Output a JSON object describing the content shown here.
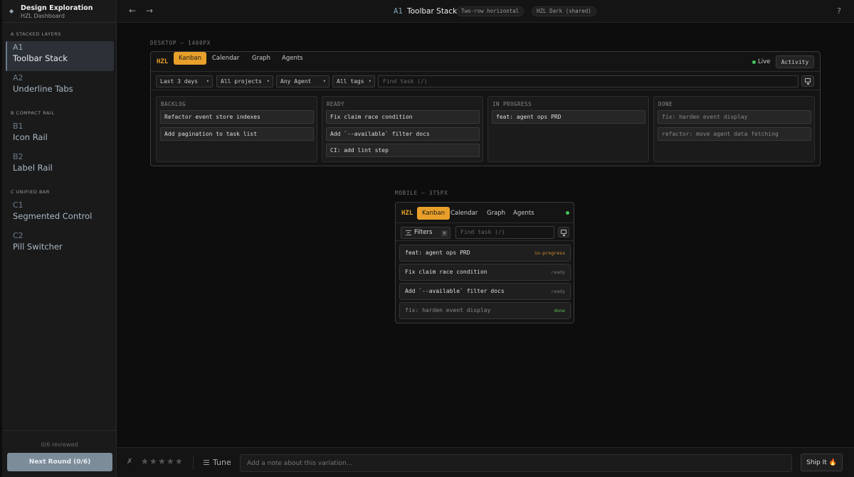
{
  "sidebar": {
    "title": "Design Exploration",
    "subtitle": "HZL Dashboard",
    "sections": [
      {
        "label": "A  STACKED LAYERS",
        "items": [
          {
            "code": "A1",
            "name": "Toolbar Stack",
            "active": true
          },
          {
            "code": "A2",
            "name": "Underline Tabs",
            "active": false
          }
        ]
      },
      {
        "label": "B  COMPACT RAIL",
        "items": [
          {
            "code": "B1",
            "name": "Icon Rail",
            "active": false
          },
          {
            "code": "B2",
            "name": "Label Rail",
            "active": false
          }
        ]
      },
      {
        "label": "C  UNIFIED BAR",
        "items": [
          {
            "code": "C1",
            "name": "Segmented Control",
            "active": false
          },
          {
            "code": "C2",
            "name": "Pill Switcher",
            "active": false
          }
        ]
      }
    ],
    "reviewed": "0/6 reviewed",
    "next_round": "Next Round (0/6)"
  },
  "topbar": {
    "back": "←",
    "forward": "→",
    "code": "A1",
    "title": "Toolbar Stack",
    "tag_layout": "Two-row horizontal",
    "separator": "·",
    "tag_theme": "HZL Dark (shared)",
    "help": "?"
  },
  "desktop": {
    "label": "DESKTOP — 1400PX",
    "logo": "HZL",
    "tabs": [
      "Kanban",
      "Calendar",
      "Graph",
      "Agents"
    ],
    "active_tab": "Kanban",
    "live": "Live",
    "activity": "Activity",
    "filters": [
      "Last 3 days",
      "All projects",
      "Any Agent",
      "All tags"
    ],
    "caret": "▾",
    "search_placeholder": "Find task (/)",
    "columns": [
      {
        "title": "BACKLOG",
        "cards": [
          {
            "text": "Refactor event store indexes",
            "dim": false
          },
          {
            "text": "Add pagination to task list",
            "dim": false
          }
        ]
      },
      {
        "title": "READY",
        "cards": [
          {
            "text": "Fix claim race condition",
            "dim": false
          },
          {
            "text": "Add `--available` filter docs",
            "dim": false
          },
          {
            "text": "CI: add lint step",
            "dim": false
          }
        ]
      },
      {
        "title": "IN PROGRESS",
        "cards": [
          {
            "text": "feat: agent ops PRD",
            "dim": false
          }
        ]
      },
      {
        "title": "DONE",
        "cards": [
          {
            "text": "fix: harden event display",
            "dim": true
          },
          {
            "text": "refactor: move agent data fetching",
            "dim": true
          }
        ]
      }
    ]
  },
  "mobile": {
    "label": "MOBILE — 375PX",
    "logo": "HZL",
    "tabs": [
      "Kanban",
      "Calendar",
      "Graph",
      "Agents"
    ],
    "active_tab": "Kanban",
    "filters_label": "Filters",
    "filters_count": "0",
    "search_placeholder": "Find task (/)",
    "tasks": [
      {
        "text": "feat: agent ops PRD",
        "status": "in-progress",
        "status_color": "#d9922a",
        "dim": false
      },
      {
        "text": "Fix claim race condition",
        "status": "ready",
        "status_color": "#777777",
        "dim": false
      },
      {
        "text": "Add `--available` filter docs",
        "status": "ready",
        "status_color": "#777777",
        "dim": false
      },
      {
        "text": "fix: harden event display",
        "status": "done",
        "status_color": "#5cbf4f",
        "dim": true
      }
    ]
  },
  "bottombar": {
    "reject": "✗",
    "rating": 0,
    "rating_max": 5,
    "star": "★",
    "tune": "Tune",
    "note_placeholder": "Add a note about this variation...",
    "ship": "Ship It",
    "ship_icon": "🔥"
  },
  "colors": {
    "accent": "#e8a02a",
    "live": "#47c25a",
    "next_round_button": "#7c8c99"
  }
}
